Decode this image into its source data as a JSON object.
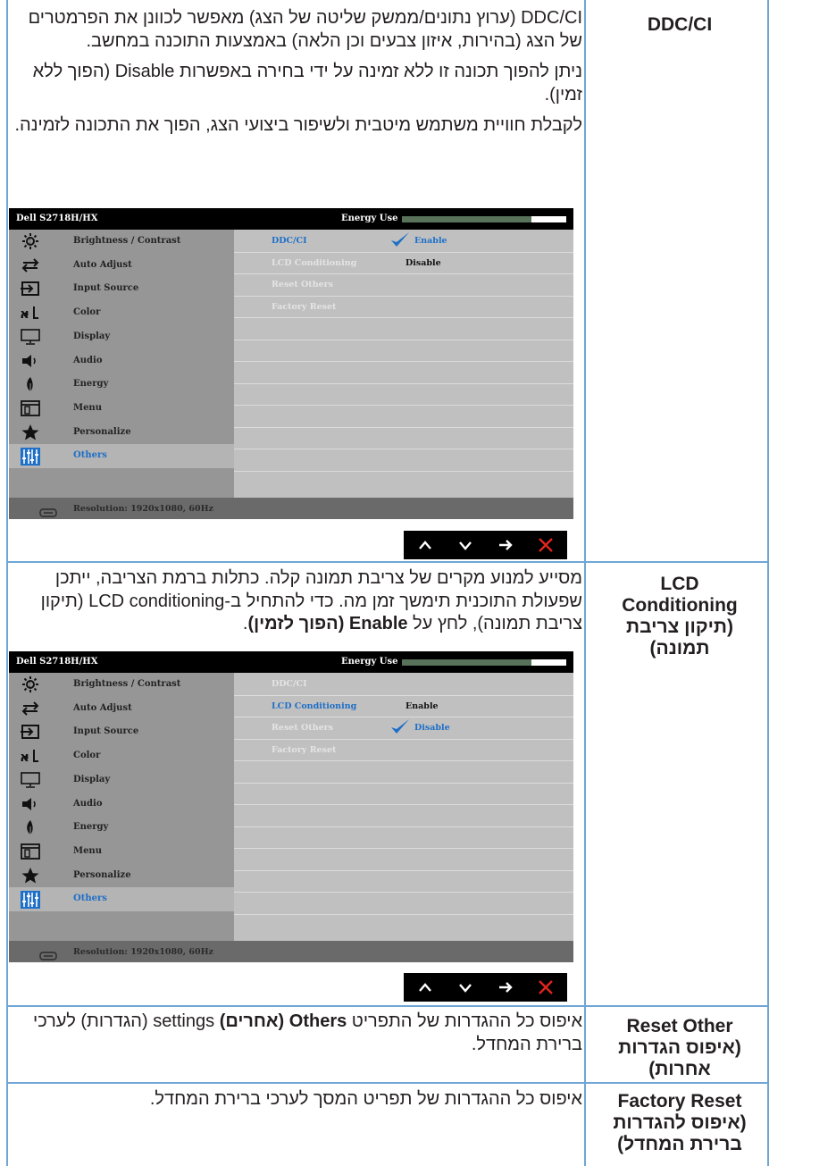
{
  "rows": [
    {
      "label": [
        "DDC/CI"
      ],
      "paragraphs": [
        [
          {
            "t": "DDC/CI (ערוץ נתונים/ממשק שליטה של הצג) מאפשר לכוונן את הפרמטרים של הצג (בהירות, איזון צבעים וכן הלאה) באמצעות התוכנה במחשב."
          }
        ],
        [
          {
            "t": "ניתן להפוך תכונה זו ללא זמינה על ידי בחירה באפשרות Disable (הפוך ללא זמין)."
          }
        ],
        [
          {
            "t": "לקבלת חוויית משתמש מיטבית ולשיפור ביצועי הצג, הפוך את התכונה לזמינה."
          }
        ]
      ]
    },
    {
      "label": [
        "LCD",
        "Conditioning",
        "(תיקון צריבת",
        "תמונה)"
      ],
      "paragraphs": [
        [
          {
            "t": "מסייע למנוע מקרים של צריבת תמונה קלה. כתלות ברמת הצריבה, ייתכן שפעולת התוכנית תימשך זמן מה. כדי להתחיל ב-LCD conditioning (תיקון צריבת תמונה), לחץ על "
          },
          {
            "t": "Enable (הפוך לזמין)",
            "b": true
          },
          {
            "t": "."
          }
        ]
      ]
    },
    {
      "label": [
        "Reset Other",
        "(איפוס הגדרות",
        "אחרות)"
      ],
      "paragraphs": [
        [
          {
            "t": "איפוס כל ההגדרות של התפריט "
          },
          {
            "t": "Others (אחרים)",
            "b": true
          },
          {
            "t": " settings (הגדרות) לערכי ברירת המחדל."
          }
        ]
      ]
    },
    {
      "label": [
        "Factory Reset",
        "(איפוס להגדרות",
        "ברירת המחדל)"
      ],
      "paragraphs": [
        [
          {
            "t": "איפוס כל ההגדרות של תפריט המסך לערכי ברירת המחדל."
          }
        ]
      ]
    }
  ],
  "osd": {
    "model": "Dell S2718H/HX",
    "energy_label": "Energy Use",
    "energy_level": 0.79,
    "resolution": "Resolution: 1920x1080, 60Hz",
    "menu_items": [
      {
        "label": "Brightness / Contrast",
        "icon": "sun-icon"
      },
      {
        "label": "Auto Adjust",
        "icon": "auto-adjust-icon"
      },
      {
        "label": "Input Source",
        "icon": "input-source-icon"
      },
      {
        "label": "Color",
        "icon": "color-icon"
      },
      {
        "label": "Display",
        "icon": "monitor-icon"
      },
      {
        "label": "Audio",
        "icon": "speaker-icon"
      },
      {
        "label": "Energy",
        "icon": "leaf-icon"
      },
      {
        "label": "Menu",
        "icon": "menu-icon"
      },
      {
        "label": "Personalize",
        "icon": "star-icon"
      },
      {
        "label": "Others",
        "icon": "sliders-icon"
      }
    ],
    "selected_menu": "Others",
    "submenu": [
      "DDC/CI",
      "LCD Conditioning",
      "Reset Others",
      "Factory Reset"
    ],
    "option_enable": "Enable",
    "option_disable": "Disable",
    "screens": [
      {
        "active_row": 0,
        "opts_row": 0,
        "checked": "Enable"
      },
      {
        "active_row": 1,
        "opts_row": 1,
        "checked": "Disable"
      }
    ],
    "nav_buttons": [
      "up-arrow-icon",
      "down-arrow-icon",
      "right-arrow-icon",
      "close-icon"
    ],
    "nav_colors": {
      "arrow": "#ffffff",
      "close": "#e0261b"
    }
  },
  "colors": {
    "grid": "#6fa6d6",
    "accent": "#1e6fc8"
  }
}
